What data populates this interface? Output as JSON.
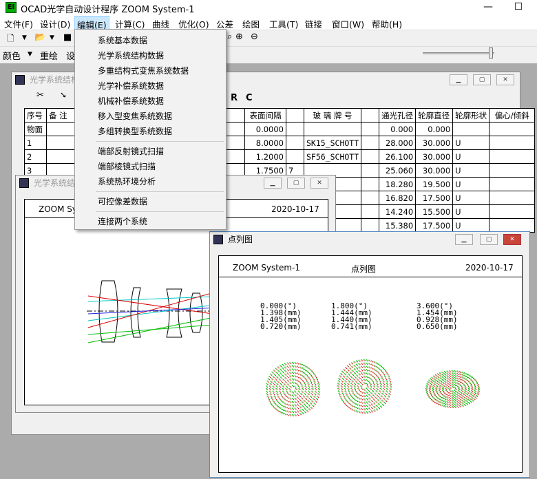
{
  "app": {
    "icon_text": "EI",
    "title": "OCAD光学自动设计程序  ZOOM System-1",
    "min_glyph": "—",
    "max_glyph": "☐"
  },
  "menubar": {
    "file": "文件(F)",
    "design": "设计(D)",
    "edit": "编辑(E)",
    "calc": "计算(C)",
    "curve": "曲线",
    "optimize": "优化(O)",
    "tolerance": "公差",
    "draw": "绘图",
    "tools": "工具(T)",
    "link": "链接",
    "window": "窗口(W)",
    "help": "帮助(H)"
  },
  "toolbar": {
    "color": "颜色",
    "redraw": "重绘",
    "settings": "设"
  },
  "edit_menu": {
    "items": [
      "系统基本数据",
      "光学系统结构数据",
      "多重结构式变焦系统数据",
      "光学补偿系统数据",
      "机械补偿系统数据",
      "移入型变焦系统数据",
      "多组转换型系统数据",
      "端部反射镜式扫描",
      "端部棱镜式扫描",
      "系统热环境分析",
      "可控像差数据",
      "连接两个系统"
    ]
  },
  "table_window": {
    "title": "光学系统结构",
    "tool_r": "R",
    "tool_c": "C",
    "headers": [
      "序号",
      "备 注",
      "",
      "表面间隔",
      "",
      "玻 璃 牌 号",
      "",
      "通光孔径",
      "轮廓直径",
      "轮廓形状",
      "偏心/倾斜"
    ],
    "rows": [
      [
        "物面",
        "",
        "",
        "0.0000",
        "",
        "",
        "",
        "0.000",
        "0.000",
        "",
        ""
      ],
      [
        "1",
        "",
        "",
        "8.0000",
        "",
        "SK15_SCHOTT",
        "",
        "28.000",
        "30.000",
        "U",
        ""
      ],
      [
        "2",
        "",
        "",
        "1.2000",
        "",
        "SF56_SCHOTT",
        "",
        "26.100",
        "30.000",
        "U",
        ""
      ],
      [
        "3",
        "",
        "",
        "1.7500",
        "7",
        "",
        "",
        "25.060",
        "30.000",
        "U",
        ""
      ],
      [
        "",
        "",
        "",
        "",
        "",
        "",
        "",
        "18.280",
        "19.500",
        "U",
        ""
      ],
      [
        "",
        "",
        "",
        "",
        "",
        "",
        "",
        "16.820",
        "17.500",
        "U",
        ""
      ],
      [
        "",
        "",
        "",
        "",
        "",
        "",
        "",
        "14.240",
        "15.500",
        "U",
        ""
      ],
      [
        "",
        "",
        "",
        "",
        "",
        "",
        "",
        "15.380",
        "17.500",
        "U",
        ""
      ]
    ]
  },
  "layout_window": {
    "title": "光学系统结",
    "system": "ZOOM Sy",
    "date": "2020-10-17"
  },
  "spot_window": {
    "title": "点列图",
    "system": "ZOOM System-1",
    "chart_title": "点列图",
    "date": "2020-10-17",
    "fields": [
      {
        "angle": "0.000(°)",
        "l1": "1.398(mm)",
        "l2": "1.405(mm)",
        "l3": "0.720(mm)"
      },
      {
        "angle": "1.800(°)",
        "l1": "1.444(mm)",
        "l2": "1.440(mm)",
        "l3": "0.741(mm)"
      },
      {
        "angle": "3.600(°)",
        "l1": "1.454(mm)",
        "l2": "0.928(mm)",
        "l3": "0.650(mm)"
      }
    ]
  },
  "colors": {
    "menu_highlight": "#cce8ff",
    "mdi_bg": "#ababab",
    "close_red": "#c9453a",
    "spot_green": "#22cc22",
    "spot_red": "#dd2222"
  }
}
